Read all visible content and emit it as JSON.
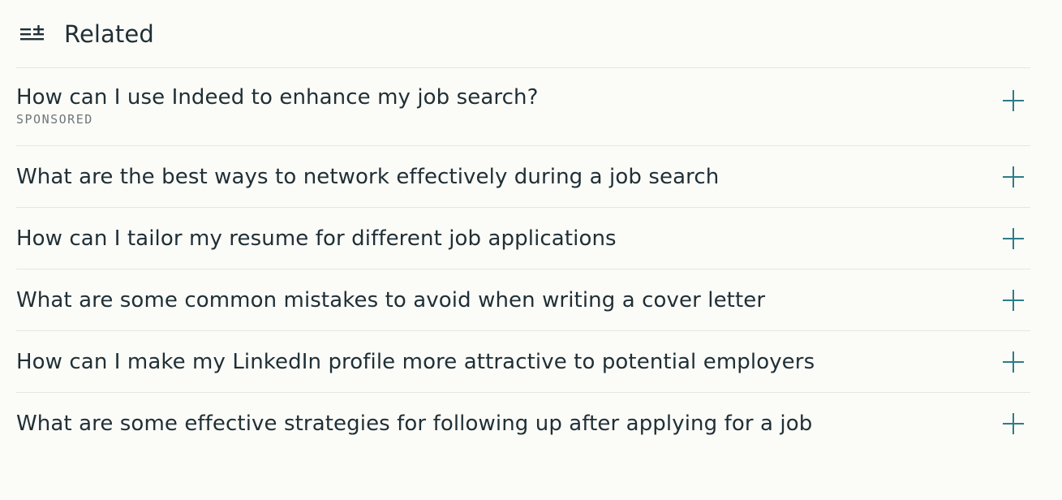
{
  "related": {
    "title": "Related",
    "items": [
      {
        "question": "How can I use Indeed to enhance my job search?",
        "tag": "SPONSORED"
      },
      {
        "question": "What are the best ways to network effectively during a job search"
      },
      {
        "question": "How can I tailor my resume for different job applications"
      },
      {
        "question": "What are some common mistakes to avoid when writing a cover letter"
      },
      {
        "question": "How can I make my LinkedIn profile more attractive to potential employers"
      },
      {
        "question": "What are some effective strategies for following up after applying for a job"
      }
    ]
  },
  "icons": {
    "header": "related-list-icon",
    "expand": "plus-icon"
  },
  "colors": {
    "accent": "#2b7d86",
    "text": "#1f2f35",
    "muted": "#6f7679",
    "divider": "#e6e6e1",
    "background": "#fbfbf8"
  }
}
